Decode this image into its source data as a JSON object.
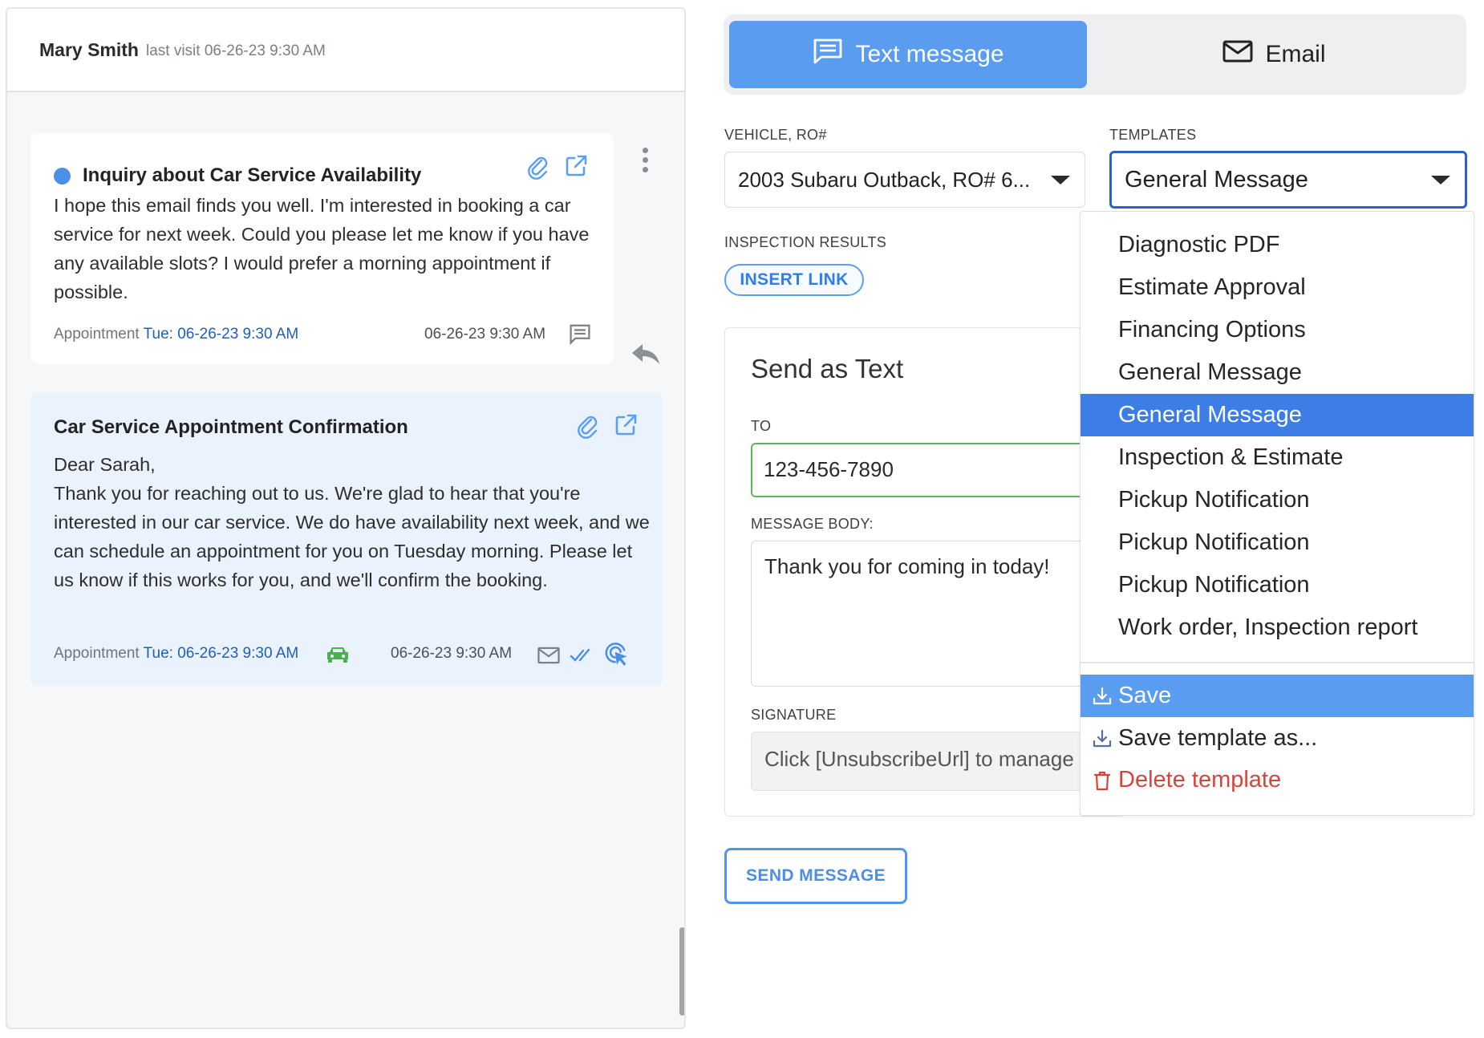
{
  "conversation": {
    "customer_name": "Mary Smith",
    "last_visit": "last visit 06-26-23 9:30 AM",
    "messages": [
      {
        "title": "Inquiry about Car Service Availability",
        "body": "I hope this email finds you well. I'm interested in booking a car service for next week. Could you please let me know if you have any available slots? I would prefer a morning appointment if possible.",
        "appointment_label": "Appointment",
        "appointment_date": "Tue: 06-26-23 9:30 AM",
        "timestamp": "06-26-23 9:30 AM",
        "channel_icon": "chat-icon",
        "unread": true
      },
      {
        "title": "Car Service Appointment Confirmation",
        "greeting": "Dear Sarah,",
        "body": "Thank you for reaching out to us. We're glad to hear that you're interested in our car service. We do have availability next week, and we can schedule an appointment for you on Tuesday morning. Please let us know if this works for you, and we'll confirm the booking.",
        "appointment_label": "Appointment",
        "appointment_date": "Tue: 06-26-23 9:30 AM",
        "timestamp": "06-26-23 9:30 AM",
        "channel_icon": "mail-icon",
        "status_icons": [
          "car-icon",
          "double-check-icon",
          "click-tracking-icon"
        ]
      }
    ]
  },
  "compose": {
    "tabs": [
      {
        "label": "Text message",
        "icon": "chat-icon",
        "active": true
      },
      {
        "label": "Email",
        "icon": "mail-icon",
        "active": false
      }
    ],
    "vehicle": {
      "label": "VEHICLE, RO#",
      "value": "2003 Subaru Outback, RO# 6..."
    },
    "templates": {
      "label": "TEMPLATES",
      "value": "General Message",
      "options": [
        "Diagnostic PDF",
        "Estimate Approval",
        "Financing Options",
        "General Message",
        "General Message",
        "Inspection & Estimate",
        "Pickup Notification",
        "Pickup Notification",
        "Pickup Notification",
        "Work order, Inspection report"
      ],
      "selected_index": 4,
      "actions": [
        {
          "label": "Save",
          "icon": "download-icon"
        },
        {
          "label": "Save template as...",
          "icon": "download-icon"
        },
        {
          "label": "Delete template",
          "icon": "trash-icon"
        }
      ]
    },
    "inspection": {
      "label": "INSPECTION RESULTS",
      "button": "INSERT LINK"
    },
    "send_as": {
      "title": "Send as Text",
      "to_label": "TO",
      "to_value": "123-456-7890",
      "body_label": "MESSAGE BODY:",
      "body_value": "Thank you for coming in today!",
      "signature_label": "SIGNATURE",
      "signature_value": "Click [UnsubscribeUrl] to manage"
    },
    "send_button": "SEND MESSAGE"
  },
  "colors": {
    "accent": "#5a9df0",
    "selected": "#3d7ee6",
    "link": "#1f5fb8",
    "danger": "#d4453d",
    "success": "#5cb85c",
    "car_icon": "#4caf50"
  }
}
